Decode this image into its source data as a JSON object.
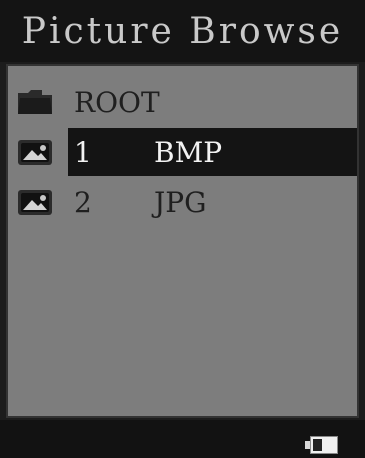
{
  "title": "Picture Browse",
  "rows": [
    {
      "kind": "folder",
      "icon": "folder-icon",
      "label": "ROOT"
    },
    {
      "kind": "file",
      "icon": "picture-file-icon",
      "index": "1",
      "type": "BMP",
      "selected": true
    },
    {
      "kind": "file",
      "icon": "picture-file-icon",
      "index": "2",
      "type": "JPG",
      "selected": false
    }
  ],
  "status": {
    "battery_icon": "battery-icon",
    "battery_level": 0.4
  },
  "colors": {
    "list_background": "#7d7d7d",
    "selection_background": "#141414",
    "title_text": "#c9c9c9"
  }
}
